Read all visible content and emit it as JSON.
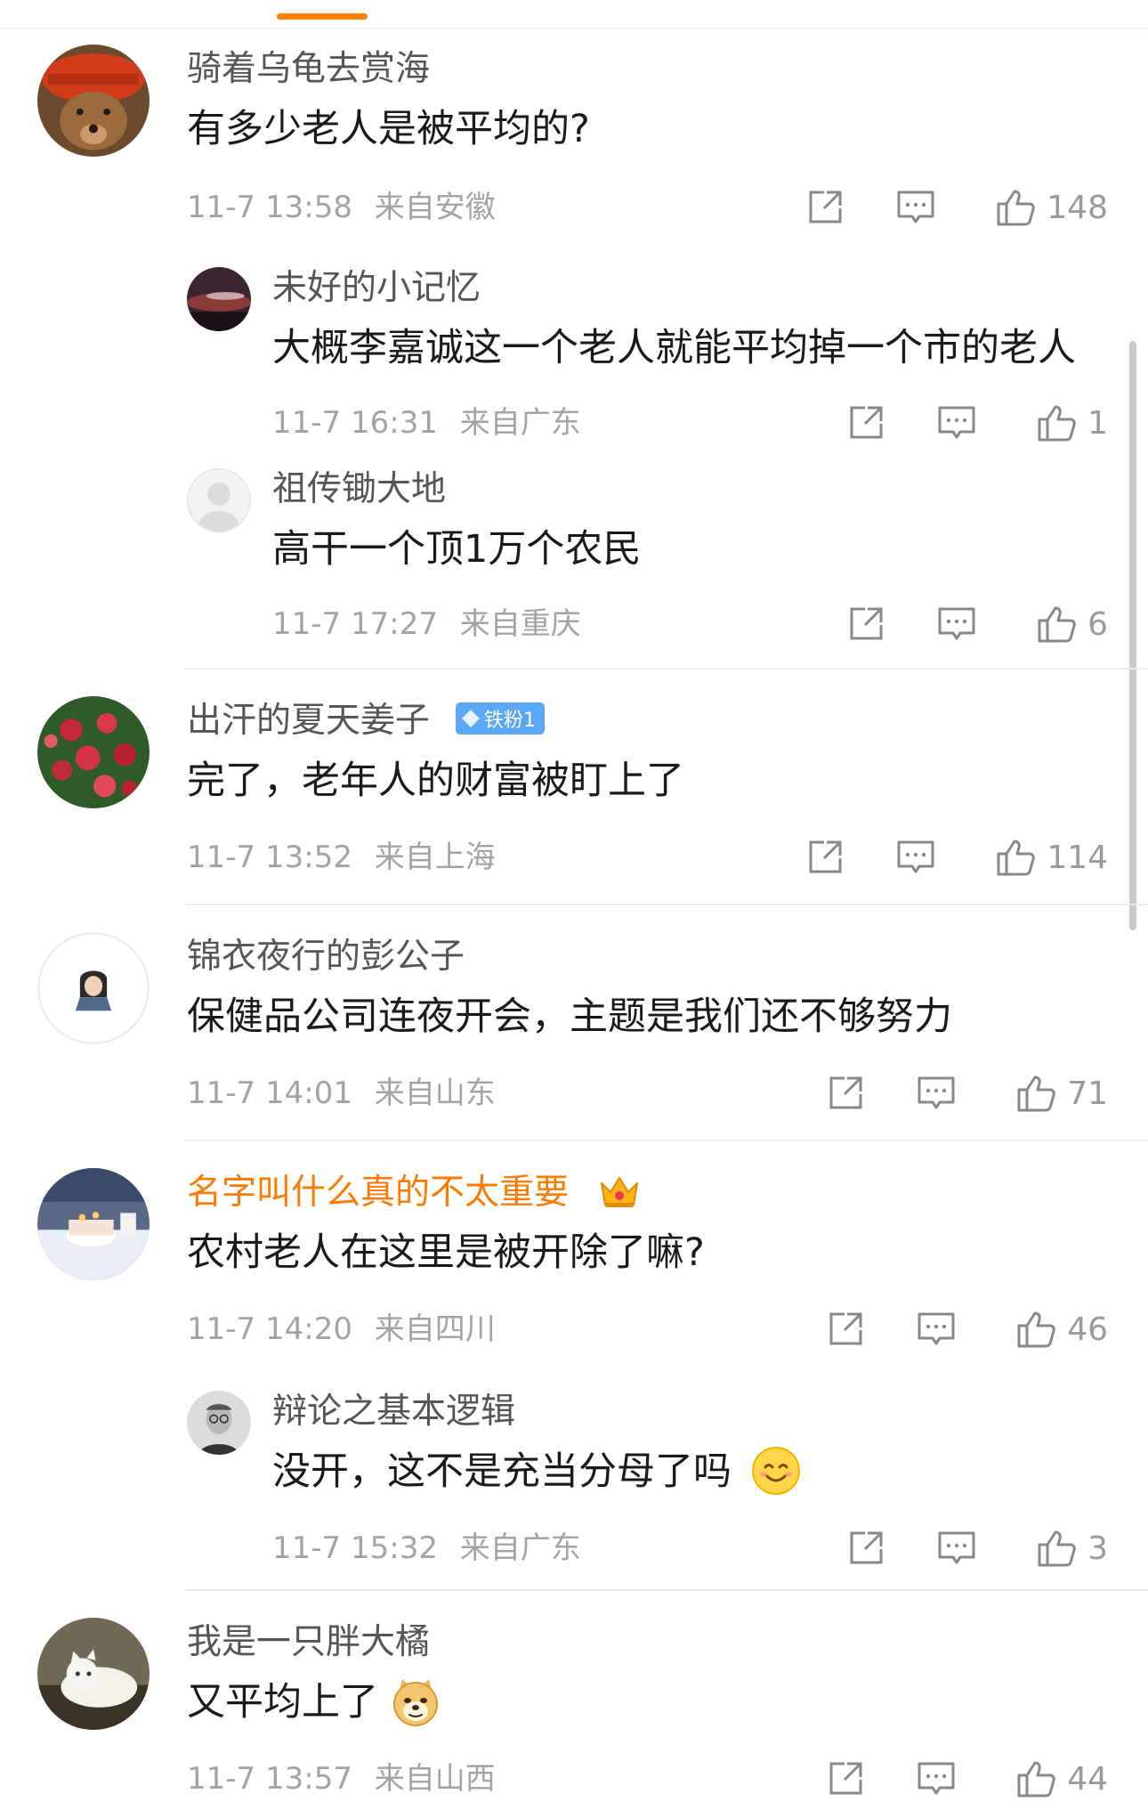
{
  "comments": [
    {
      "name": "骑着乌龟去赏海",
      "text": "有多少老人是被平均的?",
      "time": "11-7 13:58",
      "location": "来自安徽",
      "likes": "148",
      "avatar_icon": "bear-avatar",
      "replies": [
        {
          "name": "未好的小记忆",
          "text": "大概李嘉诚这一个老人就能平均掉一个市的老人",
          "time": "11-7 16:31",
          "location": "来自广东",
          "likes": "1",
          "avatar_icon": "dark-sky-avatar"
        },
        {
          "name": "祖传锄大地",
          "text": "高干一个顶1万个农民",
          "time": "11-7 17:27",
          "location": "来自重庆",
          "likes": "6",
          "avatar_icon": "default-user-avatar"
        }
      ]
    },
    {
      "name": "出汗的夏天姜子",
      "badge": "铁粉1",
      "text": "完了，老年人的财富被盯上了",
      "time": "11-7 13:52",
      "location": "来自上海",
      "likes": "114",
      "avatar_icon": "flower-bush-avatar"
    },
    {
      "name": "锦衣夜行的彭公子",
      "text": "保健品公司连夜开会，主题是我们还不够努力",
      "time": "11-7 14:01",
      "location": "来自山东",
      "likes": "71",
      "avatar_icon": "cartoon-character-avatar"
    },
    {
      "name": "名字叫什么真的不太重要",
      "text": "农村老人在这里是被开除了嘛?",
      "time": "11-7 14:20",
      "location": "来自四川",
      "likes": "46",
      "avatar_icon": "cake-table-avatar",
      "name_badge_icon": "crown-badge-icon",
      "replies": [
        {
          "name": "辩论之基本逻辑",
          "text": "没开，这不是充当分母了吗",
          "time": "11-7 15:32",
          "location": "来自广东",
          "likes": "3",
          "avatar_icon": "portrait-glasses-avatar",
          "emoji": "smile-emoji"
        }
      ]
    },
    {
      "name": "我是一只胖大橘",
      "text": "又平均上了",
      "time": "11-7 13:57",
      "location": "来自山西",
      "likes": "44",
      "avatar_icon": "white-cat-avatar",
      "emoji": "doge-emoji"
    }
  ],
  "colors": {
    "accent": "#ff8200",
    "vip_name": "#ff7a00",
    "name": "#555555",
    "meta": "#a3a3a3",
    "badge": "#5aa7f5"
  },
  "icons": {
    "share": "share-icon",
    "comment": "comment-icon",
    "like": "thumbs-up-icon"
  }
}
